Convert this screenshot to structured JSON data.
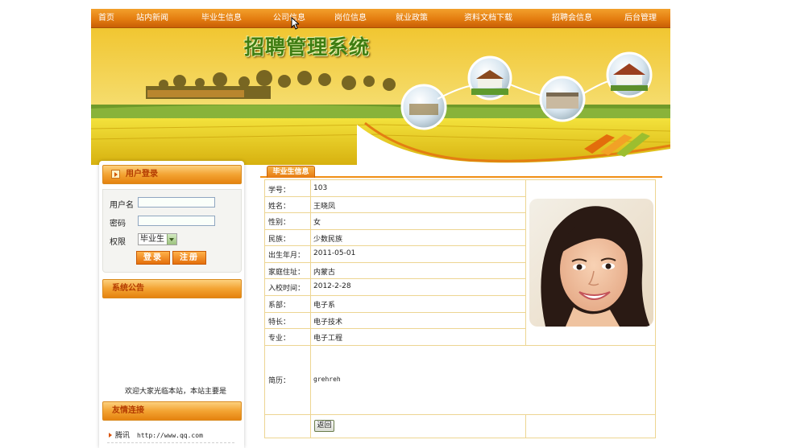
{
  "nav": {
    "items": [
      "首页",
      "站内新闻",
      "毕业生信息",
      "公司信息",
      "岗位信息",
      "就业政策",
      "资料文档下载",
      "招聘会信息",
      "后台管理"
    ]
  },
  "banner": {
    "title": "招聘管理系统"
  },
  "sidebar": {
    "login": {
      "title": "用户登录",
      "username_label": "用户名",
      "username_value": "",
      "password_label": "密码",
      "password_value": "",
      "role_label": "权限",
      "role_selected": "毕业生",
      "login_button": "登录",
      "register_button": "注册"
    },
    "notice": {
      "title": "系统公告",
      "text": "欢迎大家光临本站，本站主要是"
    },
    "links": {
      "title": "友情连接",
      "items": [
        {
          "name": "腾讯",
          "url": "http://www.qq.com"
        }
      ]
    }
  },
  "main": {
    "tab": "毕业生信息",
    "fields": [
      {
        "label": "学号：",
        "value": "103"
      },
      {
        "label": "姓名：",
        "value": "王晓凤"
      },
      {
        "label": "性别：",
        "value": "女"
      },
      {
        "label": "民族：",
        "value": "少数民族"
      },
      {
        "label": "出生年月：",
        "value": "2011-05-01"
      },
      {
        "label": "家庭住址：",
        "value": "内蒙古"
      },
      {
        "label": "入校时间：",
        "value": "2012-2-28"
      },
      {
        "label": "系部：",
        "value": "电子系"
      },
      {
        "label": "特长：",
        "value": "电子技术"
      },
      {
        "label": "专业：",
        "value": "电子工程"
      }
    ],
    "resume_label": "简历：",
    "resume_value": "grehreh",
    "back_button": "返回"
  },
  "colors": {
    "nav_orange": "#e47d10",
    "title_green": "#3f7d12",
    "table_border": "#edd592",
    "accent_orange": "#f08f14"
  }
}
